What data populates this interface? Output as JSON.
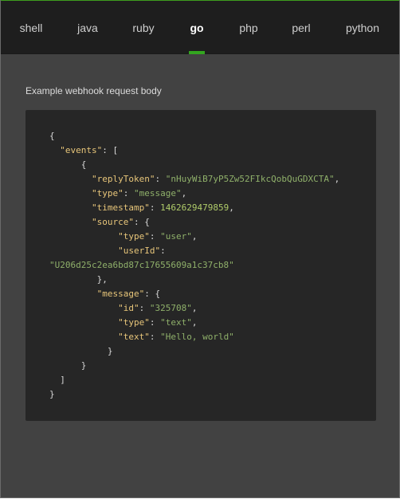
{
  "tabs": [
    {
      "label": "shell",
      "active": false
    },
    {
      "label": "java",
      "active": false
    },
    {
      "label": "ruby",
      "active": false
    },
    {
      "label": "go",
      "active": true
    },
    {
      "label": "php",
      "active": false
    },
    {
      "label": "perl",
      "active": false
    },
    {
      "label": "python",
      "active": false
    }
  ],
  "section_title": "Example webhook request body",
  "code": {
    "events_key": "\"events\"",
    "replyToken_key": "\"replyToken\"",
    "replyToken_val": "\"nHuyWiB7yP5Zw52FIkcQobQuGDXCTA\"",
    "type_key": "\"type\"",
    "type_val": "\"message\"",
    "timestamp_key": "\"timestamp\"",
    "timestamp_val": "1462629479859",
    "source_key": "\"source\"",
    "source_type_key": "\"type\"",
    "source_type_val": "\"user\"",
    "userId_key": "\"userId\"",
    "userId_val": "\"U206d25c2ea6bd87c17655609a1c37cb8\"",
    "message_key": "\"message\"",
    "id_key": "\"id\"",
    "id_val": "\"325708\"",
    "msg_type_key": "\"type\"",
    "msg_type_val": "\"text\"",
    "text_key": "\"text\"",
    "text_val": "\"Hello, world\""
  },
  "colors": {
    "accent": "#33a51f",
    "tabbar_bg": "#1e1e1e",
    "page_bg": "#424242",
    "code_bg": "#262626",
    "json_key": "#e8c67a",
    "json_string": "#8fb06a"
  }
}
